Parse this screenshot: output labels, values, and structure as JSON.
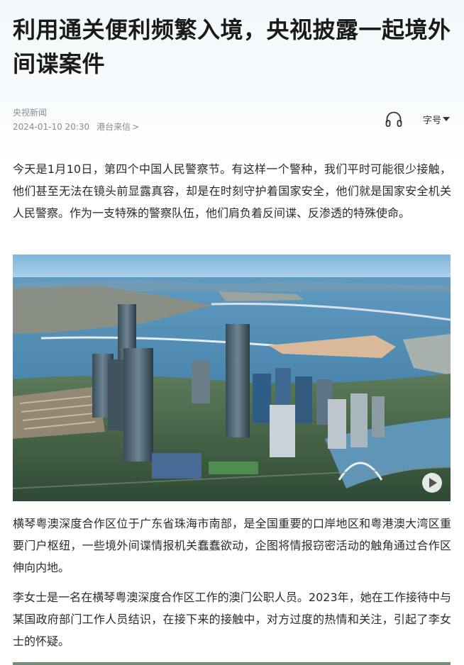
{
  "article": {
    "title": "利用通关便利频繁入境，央视披露一起境外间谍案件",
    "source": "央视新闻",
    "datetime": "2024-01-10 20:30",
    "channel": "港台来信",
    "channel_chevron": ">",
    "font_size_label": "字号",
    "paragraphs": [
      "今天是1月10日，第四个中国人民警察节。有这样一个警种，我们平时可能很少接触，他们甚至无法在镜头前显露真容，却是在时刻守护着国家安全，他们就是国家安全机关人民警察。作为一支特殊的警察队伍，他们肩负着反间谍、反渗透的特殊使命。",
      "横琴粤澳深度合作区位于广东省珠海市南部，是全国重要的口岸地区和粤港澳大湾区重要门户枢纽，一些境外间谍情报机关蠢蠢欲动，企图将情报窃密活动的触角通过合作区伸向内地。",
      "李女士是一名在横琴粤澳深度合作区工作的澳门公职人员。2023年，她在工作接待中与某国政府部门工作人员结识，在接下来的接触中，对方过度的热情和关注，引起了李女士的怀疑。"
    ]
  },
  "icons": {
    "listen": "headphones-icon",
    "font_size_caret": "caret-down-icon",
    "video_play": "play-icon"
  },
  "colors": {
    "title": "#1a1a1a",
    "meta": "#8a8f96",
    "body_text": "#2b2b2b",
    "background_top": "#f2f8fc"
  }
}
